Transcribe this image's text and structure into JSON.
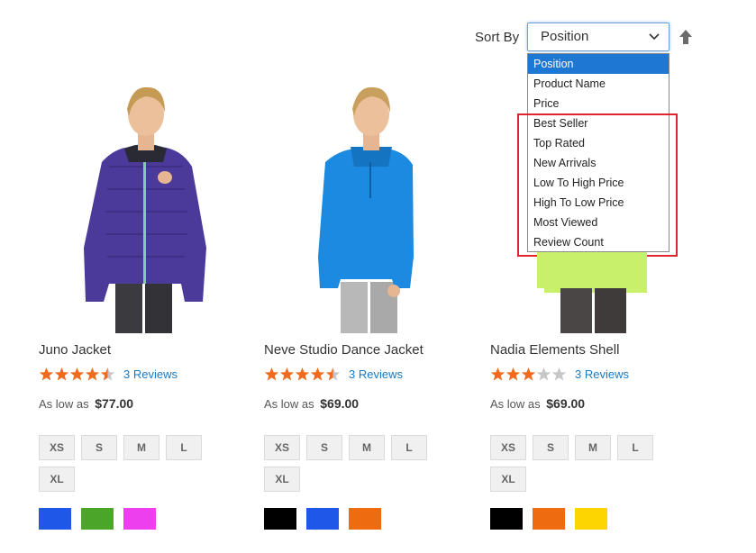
{
  "toolbar": {
    "sort_label": "Sort By",
    "selected_option": "Position",
    "options": [
      "Position",
      "Product Name",
      "Price",
      "Best Seller",
      "Top Rated",
      "New Arrivals",
      "Low To High Price",
      "High To Low Price",
      "Most Viewed",
      "Review Count"
    ],
    "direction_icon": "arrow-up-icon"
  },
  "products": [
    {
      "name": "Juno Jacket",
      "rating": 4.5,
      "reviews_label": "3 Reviews",
      "price_prefix": "As low as",
      "price": "$77.00",
      "sizes": [
        "XS",
        "S",
        "M",
        "L",
        "XL"
      ],
      "colors": [
        "#1f57e8",
        "#4aa528",
        "#ee3fee"
      ]
    },
    {
      "name": "Neve Studio Dance Jacket",
      "rating": 4.5,
      "reviews_label": "3 Reviews",
      "price_prefix": "As low as",
      "price": "$69.00",
      "sizes": [
        "XS",
        "S",
        "M",
        "L",
        "XL"
      ],
      "colors": [
        "#000000",
        "#1f57e8",
        "#ee6c0f"
      ]
    },
    {
      "name": "Nadia Elements Shell",
      "rating": 3,
      "reviews_label": "3 Reviews",
      "price_prefix": "As low as",
      "price": "$69.00",
      "sizes": [
        "XS",
        "S",
        "M",
        "L",
        "XL"
      ],
      "colors": [
        "#000000",
        "#ee6c0f",
        "#fdd500"
      ]
    }
  ],
  "colors": {
    "accent": "#1979c3",
    "star": "#f26b1d",
    "star_empty": "#c7c7c7",
    "highlight": "#e0242a",
    "selected_option_bg": "#1e77d3"
  }
}
